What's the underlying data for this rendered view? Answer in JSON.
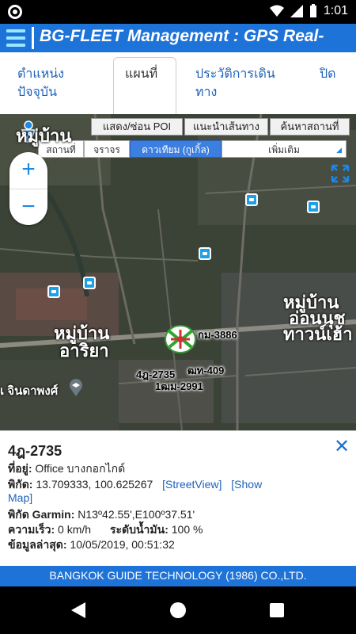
{
  "status_bar": {
    "time": "1:01",
    "battery_level": "90%"
  },
  "app_bar": {
    "title": "BG-FLEET Management : GPS Real-",
    "menu_icon": "hamburger-icon"
  },
  "tabs": [
    {
      "line1": "ตำแหน่ง",
      "line2": "ปัจจุบัน"
    },
    {
      "line1": "แผนที่",
      "line2": ""
    },
    {
      "line1": "ประวัติการเดิน",
      "line2": "ทาง"
    },
    {
      "line1": "ปิด",
      "line2": ""
    }
  ],
  "map_buttons": {
    "poi": "แสดง/ซ่อน POI",
    "route": "แนะนำเส้นทาง",
    "search": "ค้นหาสถานที่"
  },
  "map_types": {
    "place": "สถานที่",
    "traffic": "จราจร",
    "satellite": "ดาวเทียม (กูเกิ้ล)",
    "more": "เพิ่มเติม"
  },
  "zoom": {
    "plus": "+",
    "minus": "−"
  },
  "map_labels": {
    "village_top": "หมู่บ้าน",
    "village_left_1": "หมู่บ้าน",
    "village_left_2": "อาริยา",
    "village_right_1": "หมู่บ้าน",
    "village_right_2": "อ่อนนุช",
    "village_right_3": "ทาวน์เฮ้า",
    "poi_school": "เ จินดาพงศ์"
  },
  "vehicles": {
    "v1": "กม-3886",
    "v2": "4ฎ-2735",
    "v3": "ฒท-409",
    "v4": "1ฒม-2991"
  },
  "info": {
    "title": "4ฎ-2735",
    "address_label": "ที่อยู่:",
    "address_value": " Office บางกอกไกด์",
    "coord_label": "พิกัด:",
    "coord_value": " 13.709333, 100.625267",
    "streetview_link": "[StreetView]",
    "showmap_link_1": "[Show",
    "showmap_link_2": "Map]",
    "garmin_label": "พิกัด Garmin:",
    "garmin_value": " N13º42.55',E100º37.51'",
    "speed_label": "ความเร็ว:",
    "speed_value": " 0 km/h",
    "fuel_label": "ระดับน้ำมัน:",
    "fuel_value": " 100 %",
    "updated_label": "ข้อมูลล่าสุด:",
    "updated_value": " 10/05/2019, 00:51:32",
    "close": "✕"
  },
  "footer": {
    "text": "BANGKOK GUIDE TECHNOLOGY (1986) CO.,LTD."
  },
  "colors": {
    "brand": "#1e73d9",
    "link": "#1f62b8",
    "satellite_active": "#3d7fe0"
  }
}
